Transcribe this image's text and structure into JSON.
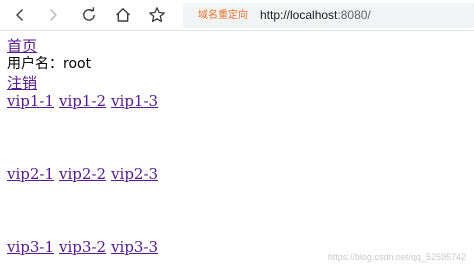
{
  "browser": {
    "redirect_tag": "域名重定向",
    "url_host": "http://localhost",
    "url_rest": ":8080/"
  },
  "page": {
    "home_link": "首页",
    "username_label": "用户名：",
    "username_value": "root",
    "logout_link": "注销",
    "vip_groups": [
      [
        "vip1-1",
        "vip1-2",
        "vip1-3"
      ],
      [
        "vip2-1",
        "vip2-2",
        "vip2-3"
      ],
      [
        "vip3-1",
        "vip3-2",
        "vip3-3"
      ]
    ]
  },
  "watermark": "https://blog.csdn.net/qq_52595742",
  "colors": {
    "link": "#551a8b",
    "redirect_tag": "#e8742a",
    "address_bar_bg": "#f1f3f4"
  },
  "icons": {
    "back": "chevron-left-icon",
    "forward": "chevron-right-icon",
    "refresh": "refresh-icon",
    "home": "home-icon",
    "favorite": "star-icon"
  }
}
